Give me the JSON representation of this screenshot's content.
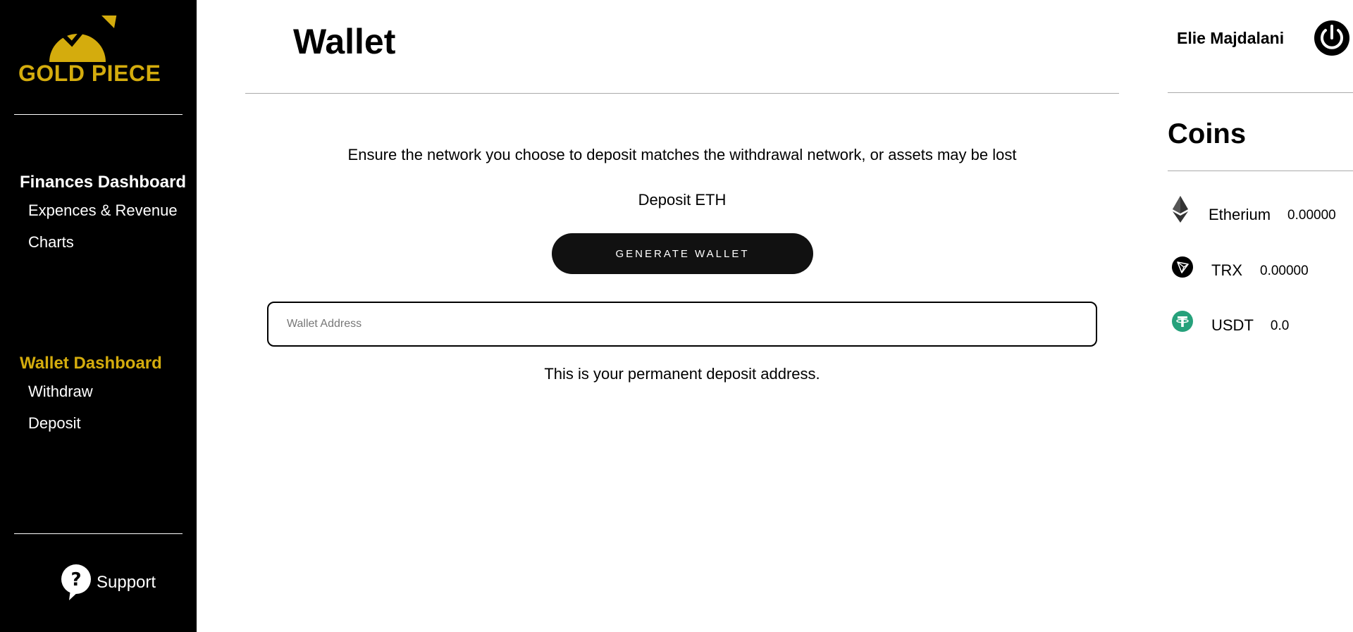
{
  "brand": {
    "name": "GOLD PIECE",
    "gold_color": "#d4ac0d"
  },
  "sidebar": {
    "finances": {
      "heading": "Finances Dashboard",
      "links": [
        "Expences & Revenue",
        "Charts"
      ]
    },
    "wallet": {
      "heading": "Wallet Dashboard",
      "links": [
        "Withdraw",
        "Deposit"
      ]
    },
    "support_label": "Support"
  },
  "header": {
    "title": "Wallet",
    "user_name": "Elie Majdalani",
    "power_icon": "power-icon"
  },
  "main": {
    "warning": "Ensure the network you choose to deposit matches the withdrawal network, or assets may be lost",
    "deposit_label": "Deposit ETH",
    "generate_button": "GENERATE WALLET",
    "wallet_placeholder": "Wallet Address",
    "wallet_value": "",
    "permanent_note": "This is your permanent deposit address."
  },
  "coins": {
    "title": "Coins",
    "items": [
      {
        "name": "Etherium",
        "amount": "0.00000",
        "icon": "ethereum-icon"
      },
      {
        "name": "TRX",
        "amount": "0.00000",
        "icon": "tron-icon"
      },
      {
        "name": "USDT",
        "amount": "0.0",
        "icon": "tether-icon"
      }
    ]
  }
}
